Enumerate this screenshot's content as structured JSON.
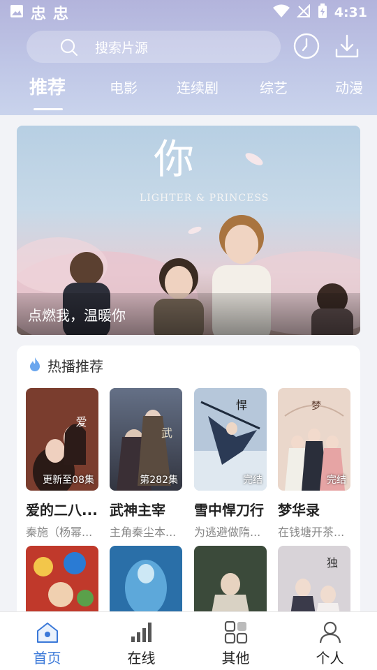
{
  "status_bar": {
    "time": "4:31",
    "app_glyphs": [
      "忠",
      "忠"
    ],
    "icons": [
      "image-icon",
      "wifi-icon",
      "signal-off-icon",
      "battery-charging-icon"
    ]
  },
  "search": {
    "placeholder": "搜索片源",
    "history_icon": "clock-icon",
    "download_icon": "download-icon"
  },
  "tabs": [
    {
      "label": "推荐",
      "active": true
    },
    {
      "label": "电影"
    },
    {
      "label": "连续剧"
    },
    {
      "label": "综艺"
    },
    {
      "label": "动漫"
    }
  ],
  "banner": {
    "caption": "点燃我，温暖你",
    "poster_title_art": "你",
    "poster_subtitle_art": "LIGHTER & PRINCESS"
  },
  "hot": {
    "title": "热播推荐",
    "icon": "flame-icon",
    "items": [
      {
        "title": "爱的二八...",
        "desc": "秦施（杨幂...",
        "badge": "更新至08集",
        "color": "#7a3d2e",
        "art": "爱的二八定律"
      },
      {
        "title": "武神主宰",
        "desc": "主角秦尘本...",
        "badge": "第282集",
        "color": "#4a5060",
        "art": "武神主宰"
      },
      {
        "title": "雪中悍刀行",
        "desc": "为逃避做隋...",
        "badge": "完结",
        "color": "#9fb4cc",
        "art": "雪中悍刀行"
      },
      {
        "title": "梦华录",
        "desc": "在钱塘开茶...",
        "badge": "完结",
        "color": "#e9d4c6",
        "art": "梦华录"
      }
    ],
    "row2_colors": [
      "#c0392b",
      "#2a6fa8",
      "#3b4a3a",
      "#d8d3d8"
    ],
    "row2_art": [
      "",
      "",
      "",
      "独"
    ]
  },
  "bottom_nav": [
    {
      "label": "首页",
      "icon": "home-icon",
      "active": true
    },
    {
      "label": "在线",
      "icon": "bar-chart-icon"
    },
    {
      "label": "其他",
      "icon": "grid-icon"
    },
    {
      "label": "个人",
      "icon": "user-icon"
    }
  ],
  "colors": {
    "accent": "#3a78d8",
    "header_gradient_top": "#b3b4dc",
    "page_bg": "#f2f3f7"
  }
}
